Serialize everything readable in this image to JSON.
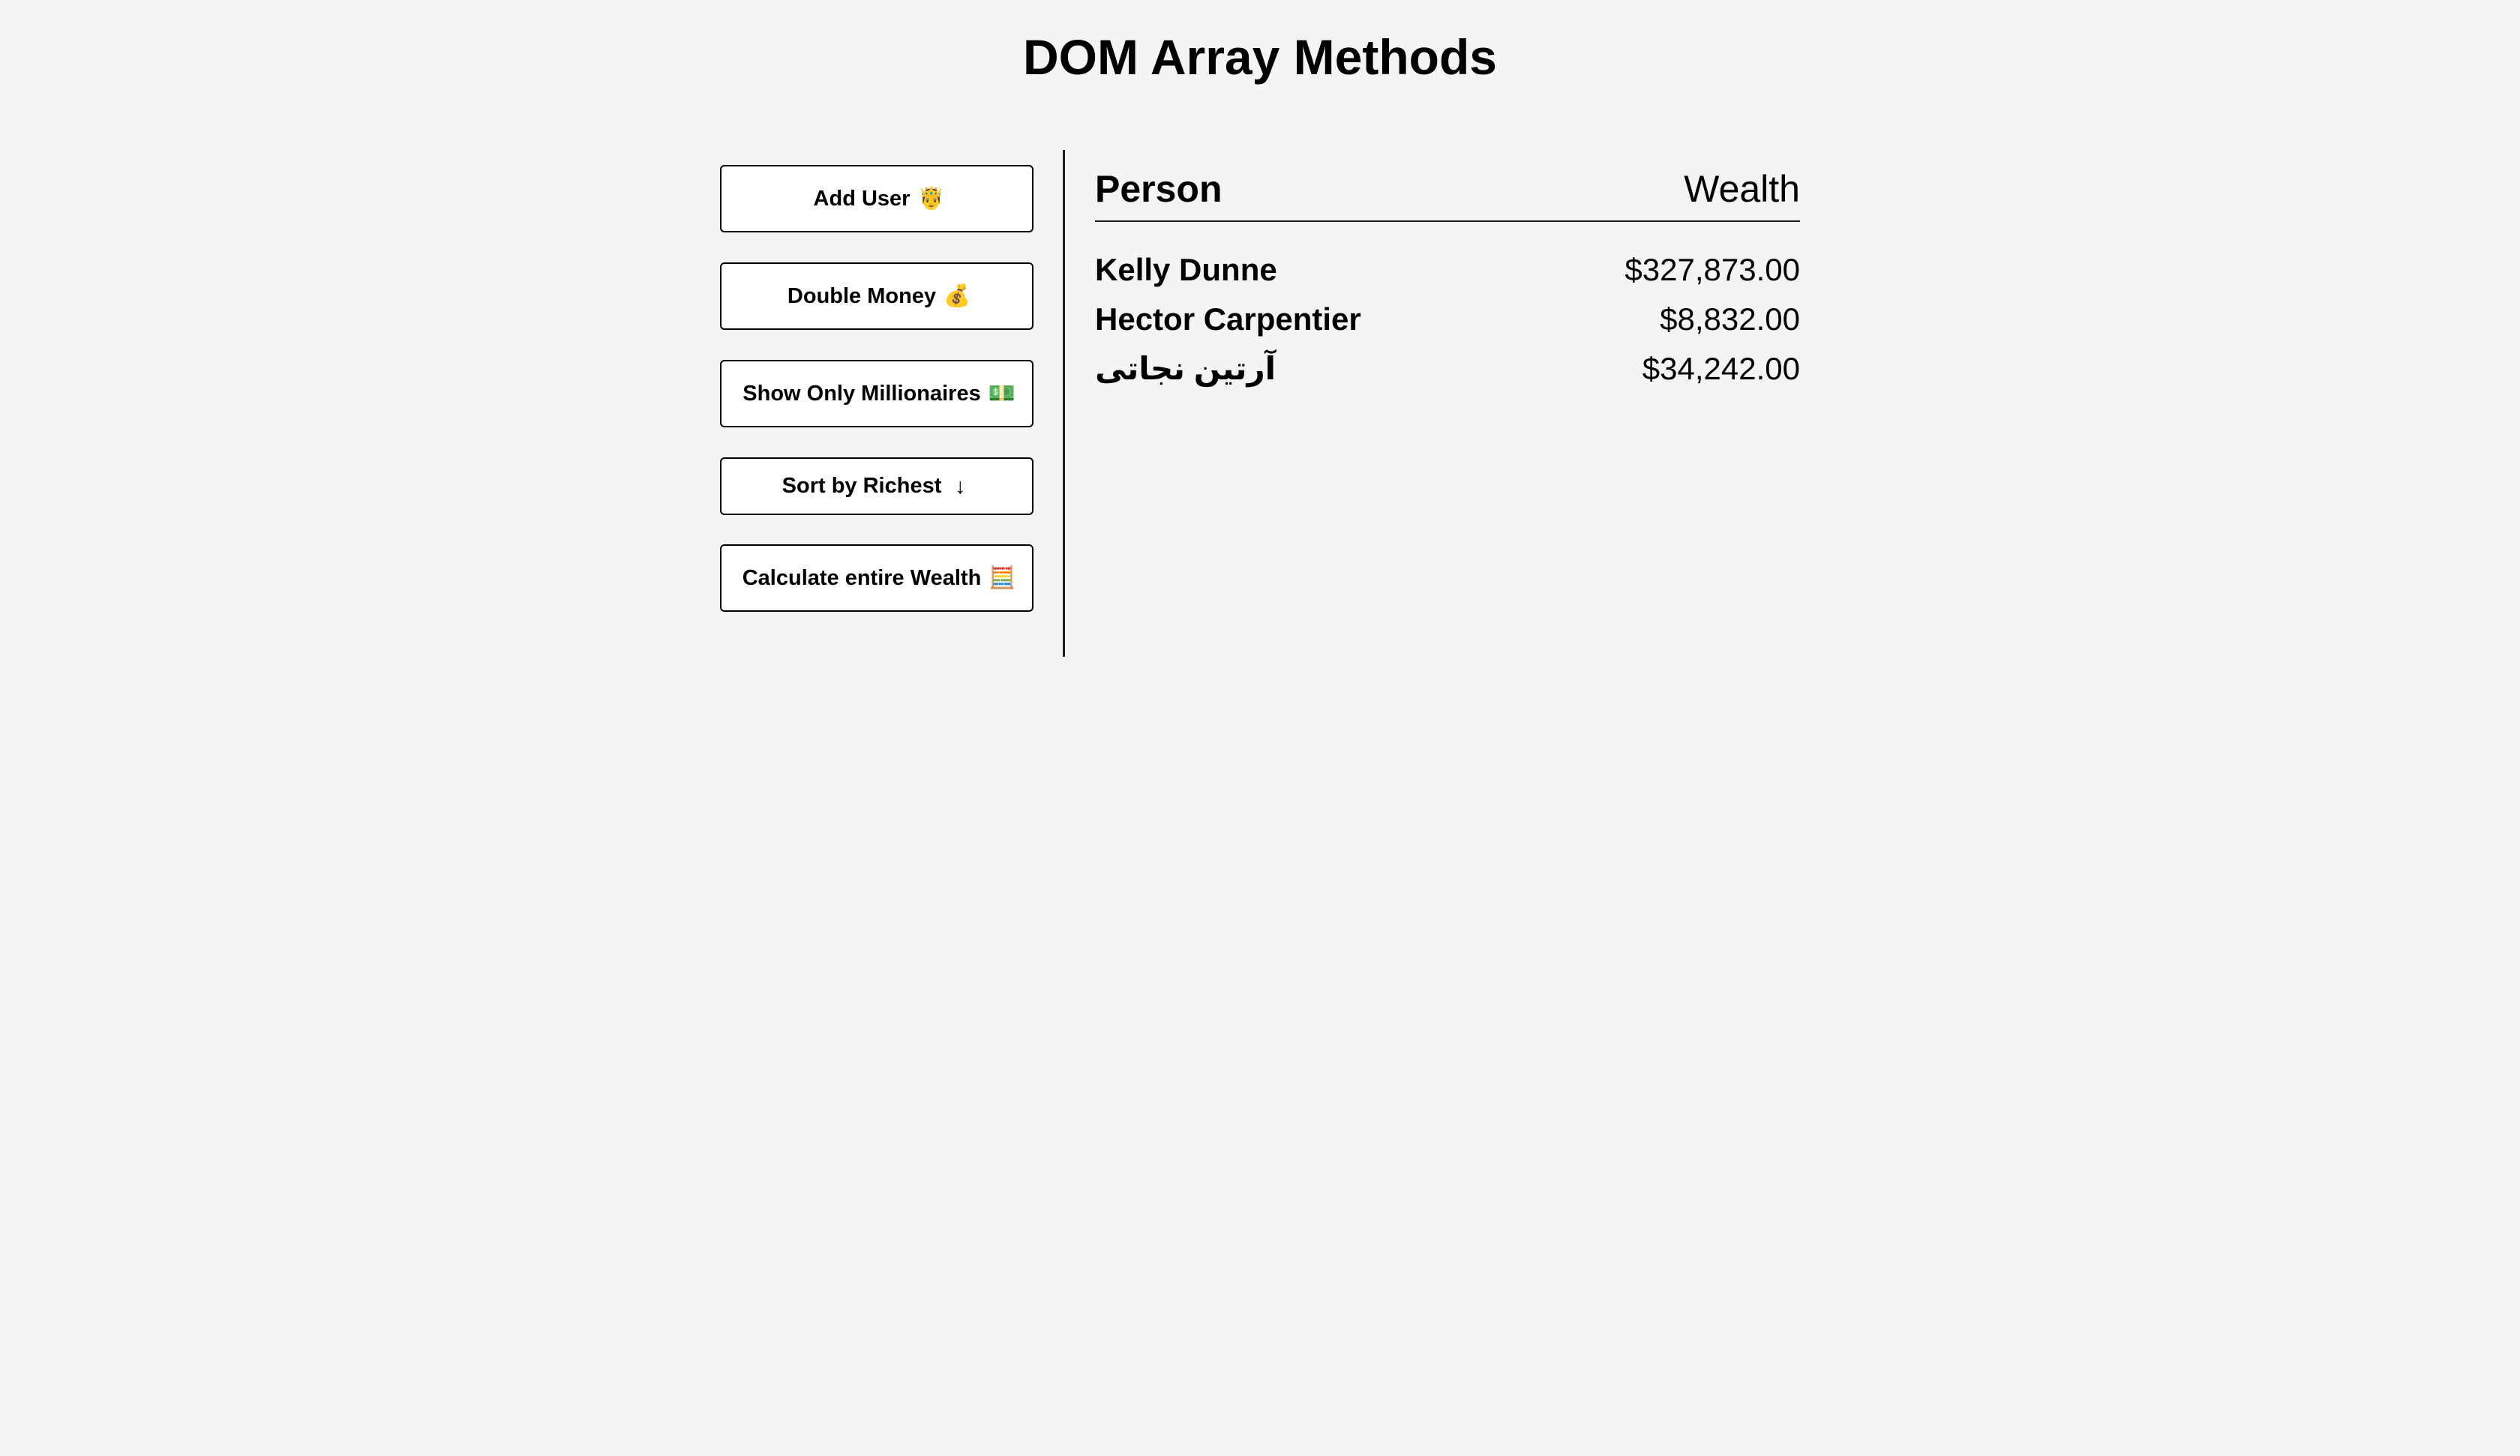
{
  "page": {
    "title": "DOM Array Methods"
  },
  "actions": [
    {
      "label": "Add User",
      "icon": "🤴",
      "icon_name": "person-icon"
    },
    {
      "label": "Double Money",
      "icon": "💰",
      "icon_name": "money-bag-icon"
    },
    {
      "label": "Show Only Millionaires",
      "icon": "💵",
      "icon_name": "banknote-icon"
    },
    {
      "label": "Sort by Richest",
      "icon": "↓",
      "icon_name": "arrow-down-icon"
    },
    {
      "label": "Calculate entire Wealth",
      "icon": "🧮",
      "icon_name": "abacus-icon"
    }
  ],
  "table": {
    "header": {
      "person": "Person",
      "wealth": "Wealth"
    },
    "rows": [
      {
        "name": "Kelly Dunne",
        "wealth": "$327,873.00"
      },
      {
        "name": "Hector Carpentier",
        "wealth": "$8,832.00"
      },
      {
        "name": "آرتین نجاتی",
        "wealth": "$34,242.00"
      }
    ]
  }
}
